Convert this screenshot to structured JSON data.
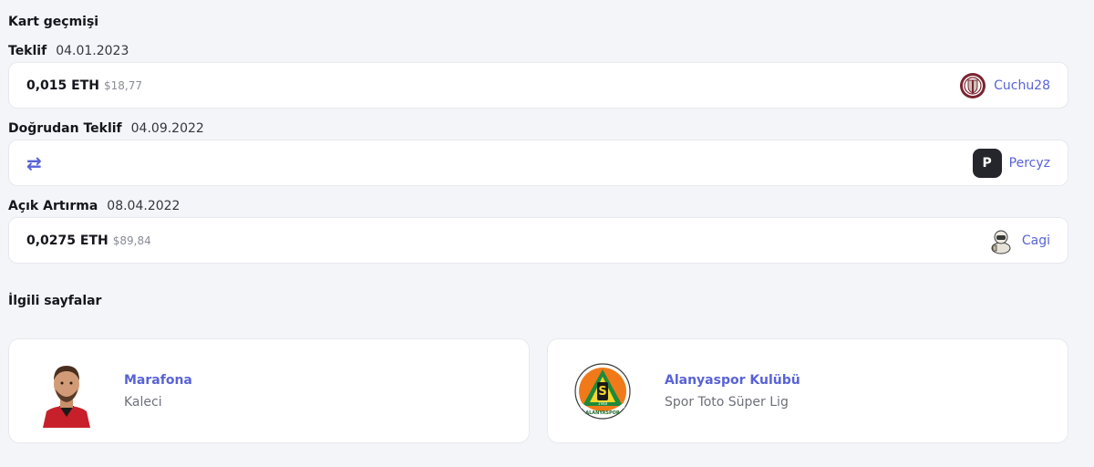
{
  "history": {
    "title": "Kart geçmişi",
    "events": [
      {
        "type": "Teklif",
        "date": "04.01.2023",
        "eth": "0,015 ETH",
        "usd": "$18,77",
        "user": "Cuchu28",
        "avatar_icon": "club-crest-icon"
      },
      {
        "type": "Doğrudan Teklif",
        "date": "04.09.2022",
        "swap_icon": "⇄",
        "user": "Percyz",
        "avatar_letter": "P"
      },
      {
        "type": "Açık Artırma",
        "date": "08.04.2022",
        "eth": "0,0275 ETH",
        "usd": "$89,84",
        "user": "Cagi",
        "avatar_icon": "astronaut-icon"
      }
    ]
  },
  "related": {
    "title": "İlgili sayfalar",
    "cards": [
      {
        "title": "Marafona",
        "subtitle": "Kaleci",
        "image": "player-photo"
      },
      {
        "title": "Alanyaspor Kulübü",
        "subtitle": "Spor Toto Süper Lig",
        "image": "club-logo",
        "logo_text": "ALANYASPOR",
        "logo_year": "1948",
        "logo_letter": "S"
      }
    ]
  },
  "colors": {
    "accent": "#5863d6",
    "background": "#f4f5f8",
    "card": "#ffffff"
  }
}
